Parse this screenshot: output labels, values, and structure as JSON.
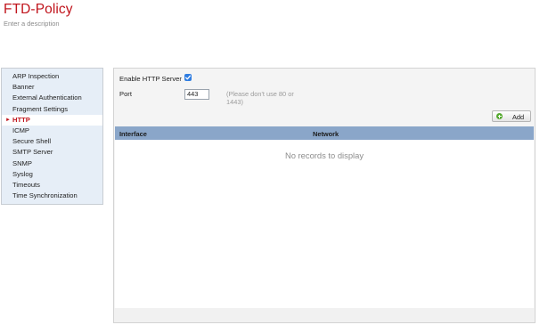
{
  "page": {
    "title": "FTD-Policy",
    "description_placeholder": "Enter a description"
  },
  "sidebar": {
    "items": [
      {
        "label": "ARP Inspection"
      },
      {
        "label": "Banner"
      },
      {
        "label": "External Authentication"
      },
      {
        "label": "Fragment Settings"
      },
      {
        "label": "HTTP",
        "active": true
      },
      {
        "label": "ICMP"
      },
      {
        "label": "Secure Shell"
      },
      {
        "label": "SMTP Server"
      },
      {
        "label": "SNMP"
      },
      {
        "label": "Syslog"
      },
      {
        "label": "Timeouts"
      },
      {
        "label": "Time Synchronization"
      }
    ],
    "active_marker": "►"
  },
  "form": {
    "enable_label": "Enable HTTP Server",
    "enable_checked": true,
    "port_label": "Port",
    "port_value": "443",
    "port_hint": "(Please don't use 80 or 1443)"
  },
  "toolbar": {
    "add_label": "Add"
  },
  "table": {
    "columns": [
      "Interface",
      "Network"
    ],
    "empty_message": "No records to display"
  },
  "colors": {
    "title": "#c0141c",
    "table_header": "#8aa6c9",
    "checkbox": "#2f7de1",
    "add_icon": "#55a92f"
  }
}
